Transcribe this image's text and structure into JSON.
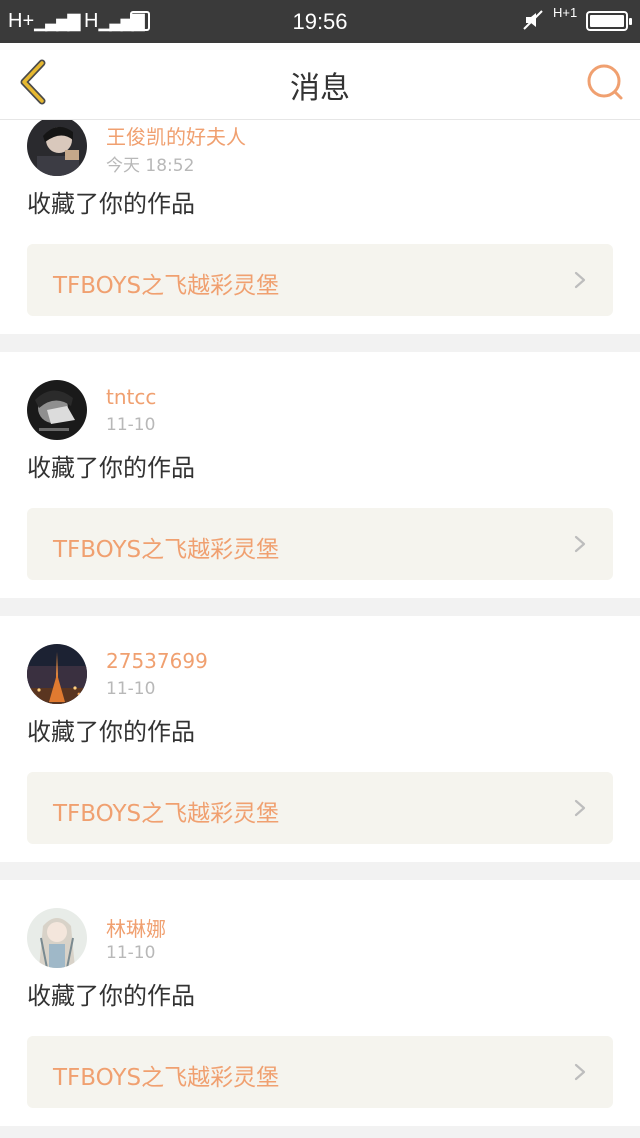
{
  "status_bar": {
    "network1": "H+",
    "network2": "H",
    "sim_label": "S",
    "time": "19:56",
    "network3": "H+1"
  },
  "nav": {
    "title": "消息"
  },
  "notifications": [
    {
      "username": "王俊凯的好夫人",
      "time": "今天 18:52",
      "action": "收藏了你的作品",
      "work_title": "TFBOYS之飞越彩灵堡",
      "avatar_icon": "avatar-dark-portrait"
    },
    {
      "username": "tntcc",
      "time": "11-10",
      "action": "收藏了你的作品",
      "work_title": "TFBOYS之飞越彩灵堡",
      "avatar_icon": "avatar-bw-portrait"
    },
    {
      "username": "27537699",
      "time": "11-10",
      "action": "收藏了你的作品",
      "work_title": "TFBOYS之飞越彩灵堡",
      "avatar_icon": "avatar-night-tower"
    },
    {
      "username": "林琳娜",
      "time": "11-10",
      "action": "收藏了你的作品",
      "work_title": "TFBOYS之飞越彩灵堡",
      "avatar_icon": "avatar-anime-girl"
    }
  ],
  "colors": {
    "accent": "#f0a070",
    "status_bar_bg": "#3a3a3a",
    "link_bg": "#f5f4ee",
    "back_arrow": "#e6b830"
  }
}
